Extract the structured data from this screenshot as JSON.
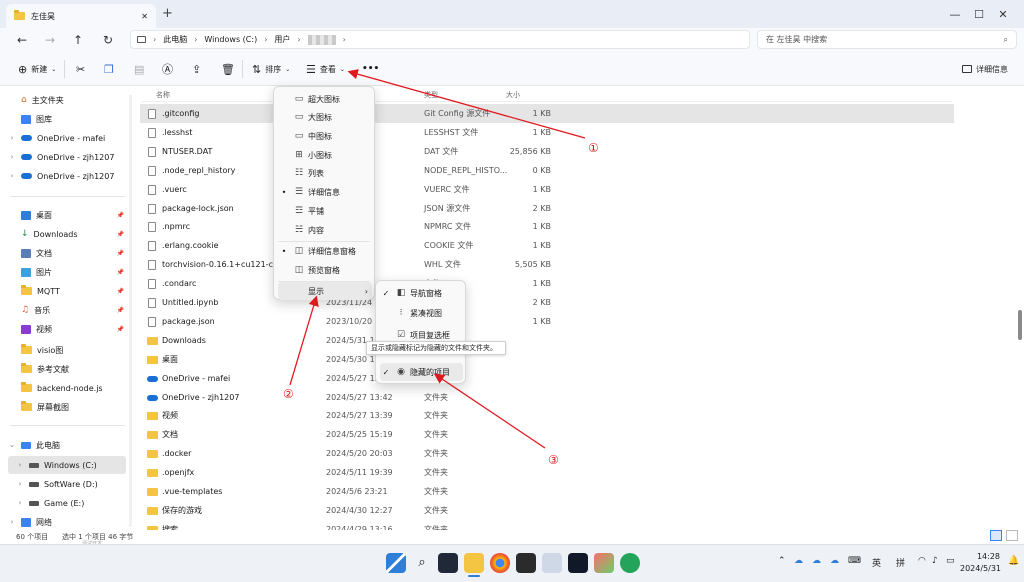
{
  "window": {
    "tab_title": "左佳昊",
    "new_tab": "+",
    "minimize": "—",
    "maximize": "☐",
    "close": "✕"
  },
  "address": {
    "crumbs": [
      "此电脑",
      "Windows (C:)",
      "用户"
    ],
    "search_placeholder": "在 左佳昊 中搜索"
  },
  "toolbar": {
    "new": "新建",
    "sort": "排序",
    "view": "查看",
    "more": "•••",
    "details_pane": "详细信息"
  },
  "sidebar": {
    "home": "主文件夹",
    "gallery": "图库",
    "onedrive": [
      "OneDrive - mafei",
      "OneDrive - zjh1207",
      "OneDrive - zjh1207"
    ],
    "pinned": [
      "桌面",
      "Downloads",
      "文档",
      "图片",
      "MQTT",
      "音乐",
      "视频"
    ],
    "folders": [
      "visio图",
      "参考文献",
      "backend-node.js",
      "屏幕截图"
    ],
    "this_pc": "此电脑",
    "drives": [
      "Windows (C:)",
      "SoftWare (D:)",
      "Game (E:)"
    ],
    "network": "网络"
  },
  "list": {
    "headers": {
      "name": "名称",
      "type": "类型",
      "size": "大小"
    },
    "rows": [
      {
        "name": ".gitconfig",
        "date": "24",
        "type": "Git Config 源文件",
        "size": "1 KB",
        "kind": "file"
      },
      {
        "name": ".lesshst",
        "date": "29",
        "type": "LESSHST 文件",
        "size": "1 KB",
        "kind": "file"
      },
      {
        "name": "NTUSER.DAT",
        "date": "45",
        "type": "DAT 文件",
        "size": "25,856 KB",
        "kind": "file"
      },
      {
        "name": ".node_repl_history",
        "date": "",
        "type": "NODE_REPL_HISTO...",
        "size": "0 KB",
        "kind": "file"
      },
      {
        "name": ".vuerc",
        "date": "",
        "type": "VUERC 文件",
        "size": "1 KB",
        "kind": "file"
      },
      {
        "name": "package-lock.json",
        "date": "",
        "type": "JSON 源文件",
        "size": "2 KB",
        "kind": "file"
      },
      {
        "name": ".npmrc",
        "date": "5",
        "type": "NPMRC 文件",
        "size": "1 KB",
        "kind": "file"
      },
      {
        "name": ".erlang.cookie",
        "date": "",
        "type": "COOKIE 文件",
        "size": "1 KB",
        "kind": "file"
      },
      {
        "name": "torchvision-0.16.1+cu121-cp38-",
        "date": "4:52",
        "type": "WHL 文件",
        "size": "5,505 KB",
        "kind": "file"
      },
      {
        "name": ".condarc",
        "date": "",
        "type": "文件",
        "size": "1 KB",
        "kind": "file"
      },
      {
        "name": "Untitled.ipynb",
        "date": "2023/11/24",
        "type": "",
        "size": "2 KB",
        "kind": "file"
      },
      {
        "name": "package.json",
        "date": "2023/10/20 1",
        "type": "",
        "size": "1 KB",
        "kind": "file"
      },
      {
        "name": "Downloads",
        "date": "2024/5/31 1",
        "type": "",
        "size": "",
        "kind": "folder"
      },
      {
        "name": "桌面",
        "date": "2024/5/30 15",
        "type": "",
        "size": "",
        "kind": "folder"
      },
      {
        "name": "OneDrive - mafei",
        "date": "2024/5/27 13:42",
        "type": "",
        "size": "",
        "kind": "cloud"
      },
      {
        "name": "OneDrive - zjh1207",
        "date": "2024/5/27 13:42",
        "type": "文件夹",
        "size": "",
        "kind": "cloud"
      },
      {
        "name": "视频",
        "date": "2024/5/27 13:39",
        "type": "文件夹",
        "size": "",
        "kind": "folder"
      },
      {
        "name": "文档",
        "date": "2024/5/25 15:19",
        "type": "文件夹",
        "size": "",
        "kind": "folder"
      },
      {
        "name": ".docker",
        "date": "2024/5/20 20:03",
        "type": "文件夹",
        "size": "",
        "kind": "folder"
      },
      {
        "name": ".openjfx",
        "date": "2024/5/11 19:39",
        "type": "文件夹",
        "size": "",
        "kind": "folder"
      },
      {
        "name": ".vue-templates",
        "date": "2024/5/6 23:21",
        "type": "文件夹",
        "size": "",
        "kind": "folder"
      },
      {
        "name": "保存的游戏",
        "date": "2024/4/30 12:27",
        "type": "文件夹",
        "size": "",
        "kind": "folder"
      },
      {
        "name": "搜索",
        "date": "2024/4/29 13:16",
        "type": "文件夹",
        "size": "",
        "kind": "folder"
      }
    ]
  },
  "view_menu": {
    "items": [
      "超大图标",
      "大图标",
      "中图标",
      "小图标",
      "列表",
      "详细信息",
      "平铺",
      "内容",
      "详细信息窗格",
      "预览窗格",
      "显示"
    ]
  },
  "show_menu": {
    "items": [
      "导航窗格",
      "紧凑视图",
      "项目复选框",
      "隐藏的项目"
    ]
  },
  "tooltip": "显示或隐藏标记为隐藏的文件和文件夹。",
  "annotations": [
    "①",
    "②",
    "③"
  ],
  "status": {
    "count": "60 个项目",
    "selected": "选中 1 个项目 46 字节",
    "below": "调试开发"
  },
  "tray": {
    "ime1": "英",
    "ime2": "拼",
    "time": "14:28",
    "date": "2024/5/31"
  }
}
